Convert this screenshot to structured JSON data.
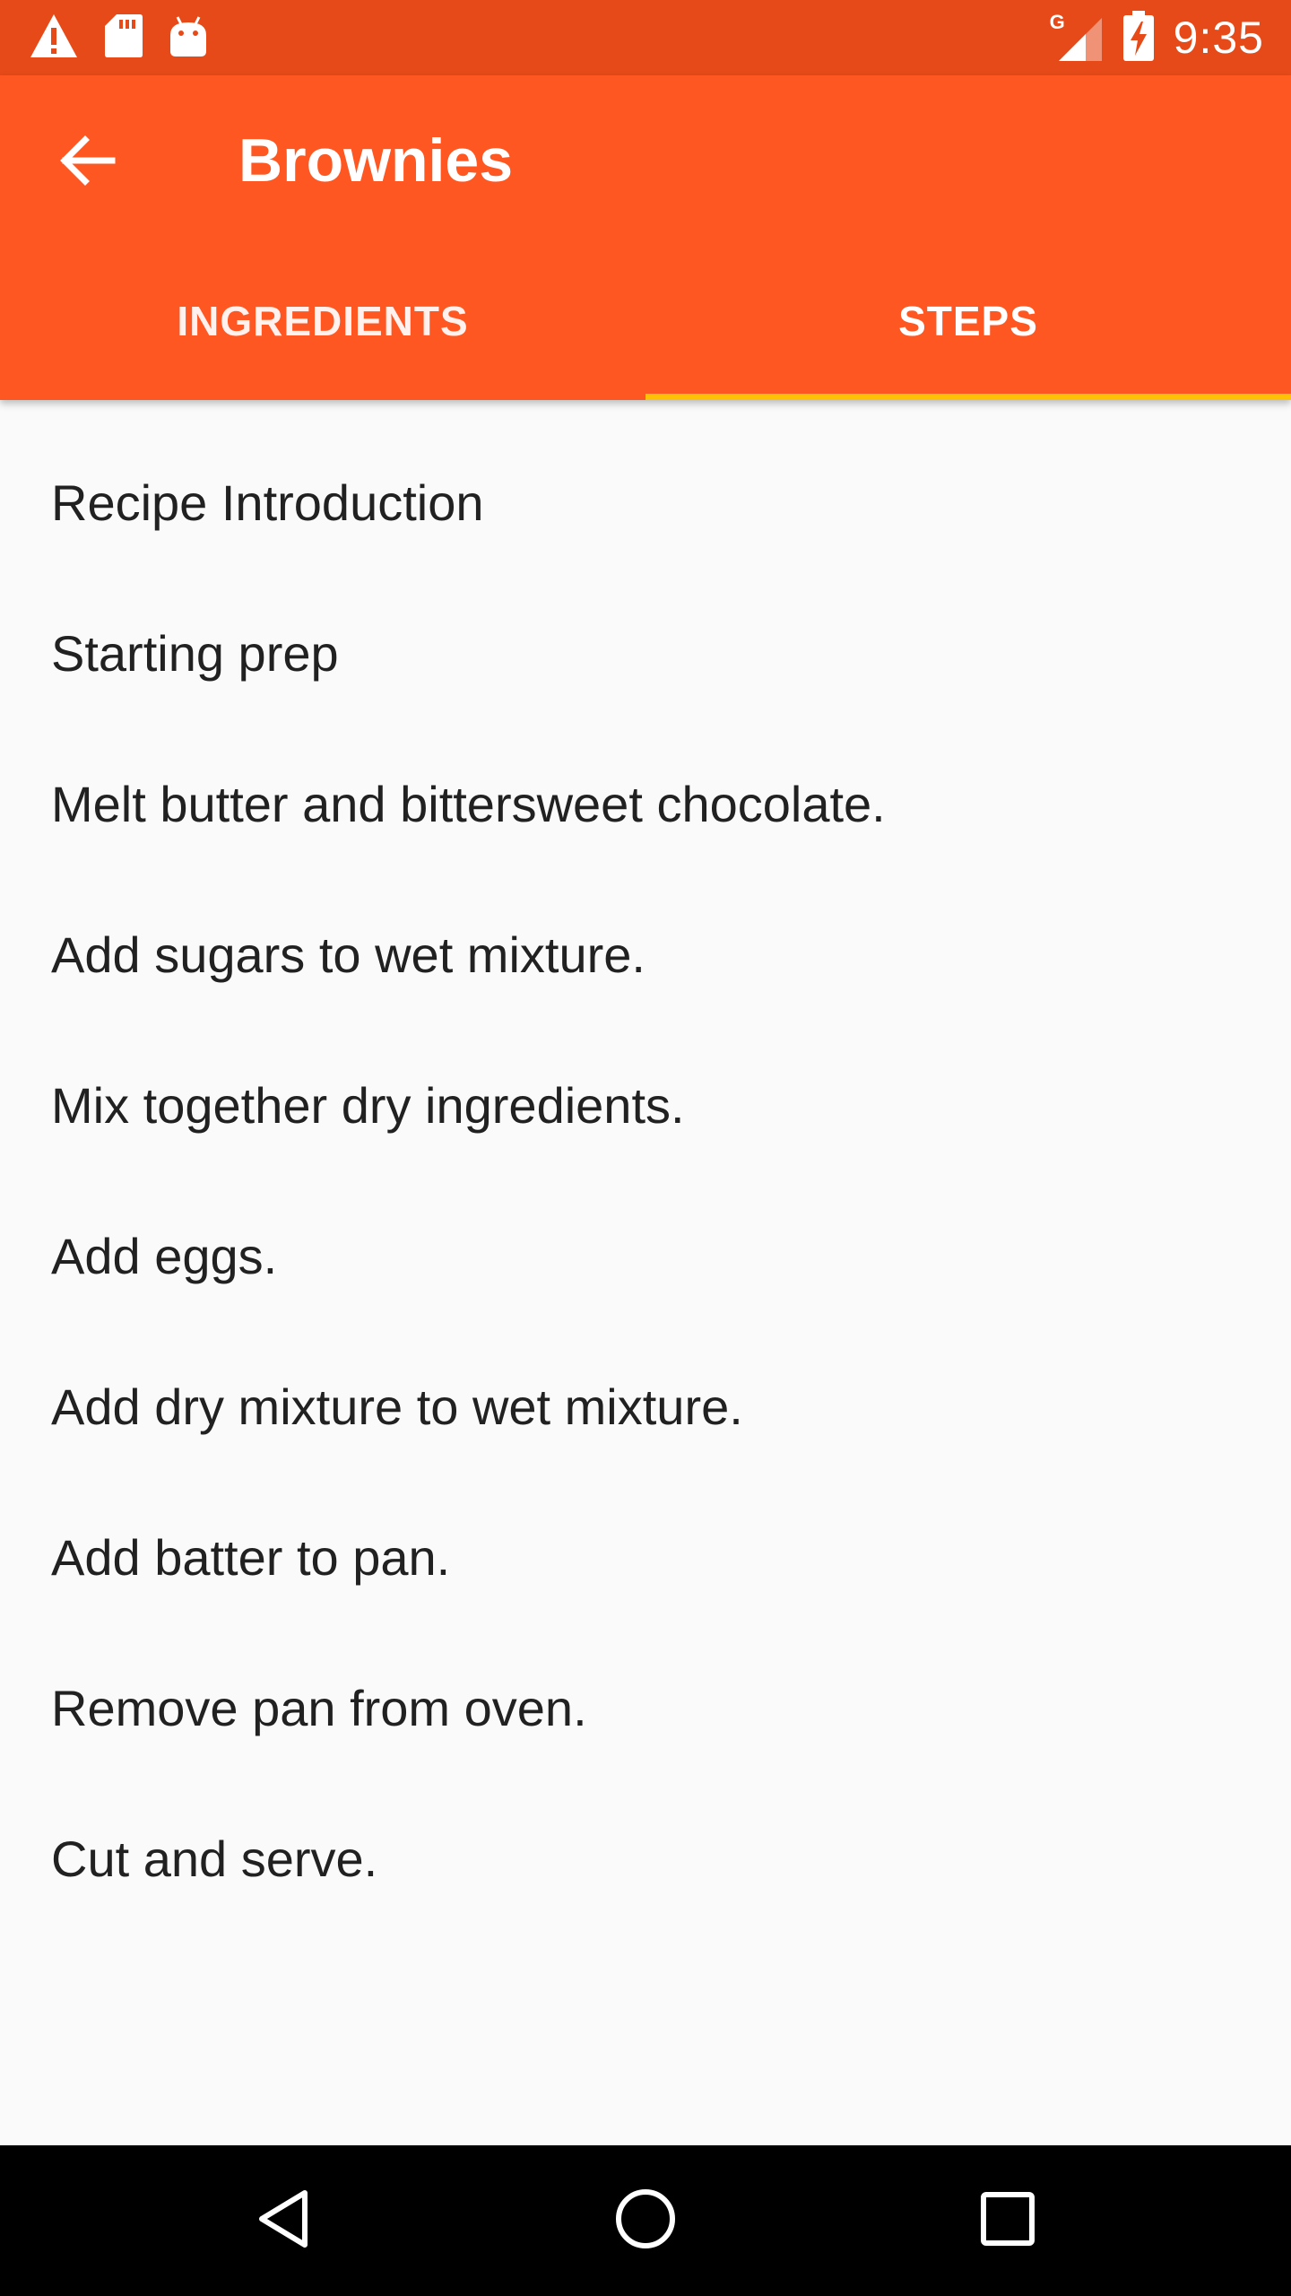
{
  "status_bar": {
    "time": "9:35",
    "network_label": "G",
    "icons": [
      "warning-icon",
      "sd-card-icon",
      "android-icon",
      "signal-icon",
      "battery-charging-icon"
    ]
  },
  "app_bar": {
    "title": "Brownies",
    "back_icon": "arrow-back-icon",
    "tabs": [
      {
        "label": "INGREDIENTS",
        "selected": false
      },
      {
        "label": "STEPS",
        "selected": true
      }
    ],
    "colors": {
      "status_bar": "#e64a19",
      "app_bar": "#ff5722",
      "tab_indicator": "#ffc107"
    }
  },
  "steps": [
    {
      "label": "Recipe Introduction"
    },
    {
      "label": "Starting prep"
    },
    {
      "label": "Melt butter and bittersweet chocolate."
    },
    {
      "label": "Add sugars to wet mixture."
    },
    {
      "label": "Mix together dry ingredients."
    },
    {
      "label": "Add eggs."
    },
    {
      "label": "Add dry mixture to wet mixture."
    },
    {
      "label": "Add batter to pan."
    },
    {
      "label": "Remove pan from oven."
    },
    {
      "label": "Cut and serve."
    }
  ],
  "nav_bar": {
    "buttons": [
      "back-triangle-icon",
      "home-circle-icon",
      "recents-square-icon"
    ]
  }
}
